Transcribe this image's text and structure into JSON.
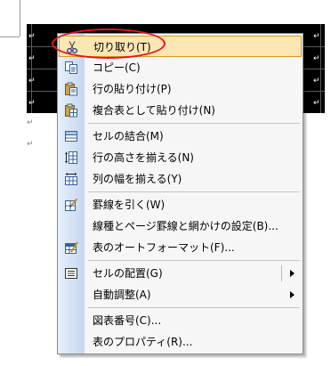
{
  "document": {
    "cell_mark": "↵",
    "paragraph_mark": "↵"
  },
  "menu": {
    "items": [
      {
        "label": "切り取り(T)",
        "icon": "scissors-icon",
        "highlighted": true,
        "has_submenu": false
      },
      {
        "label": "コピー(C)",
        "icon": "copy-icon",
        "highlighted": false,
        "has_submenu": false
      },
      {
        "label": "行の貼り付け(P)",
        "icon": "paste-icon",
        "highlighted": false,
        "has_submenu": false
      },
      {
        "label": "複合表として貼り付け(N)",
        "icon": "paste-table-icon",
        "highlighted": false,
        "has_submenu": false
      },
      {
        "label": "セルの結合(M)",
        "icon": "merge-cells-icon",
        "highlighted": false,
        "has_submenu": false
      },
      {
        "label": "行の高さを揃える(N)",
        "icon": "distribute-rows-icon",
        "highlighted": false,
        "has_submenu": false
      },
      {
        "label": "列の幅を揃える(Y)",
        "icon": "distribute-columns-icon",
        "highlighted": false,
        "has_submenu": false
      },
      {
        "label": "罫線を引く(W)",
        "icon": "draw-table-icon",
        "highlighted": false,
        "has_submenu": false
      },
      {
        "label": "線種とページ罫線と網かけの設定(B)...",
        "icon": "",
        "highlighted": false,
        "has_submenu": false
      },
      {
        "label": "表のオートフォーマット(F)...",
        "icon": "table-autoformat-icon",
        "highlighted": false,
        "has_submenu": false
      },
      {
        "label": "セルの配置(G)",
        "icon": "cell-alignment-icon",
        "highlighted": false,
        "has_submenu": true
      },
      {
        "label": "自動調整(A)",
        "icon": "",
        "highlighted": false,
        "has_submenu": true
      },
      {
        "label": "図表番号(C)...",
        "icon": "",
        "highlighted": false,
        "has_submenu": false
      },
      {
        "label": "表のプロパティ(R)...",
        "icon": "",
        "highlighted": false,
        "has_submenu": false
      }
    ]
  },
  "colors": {
    "highlight_ellipse": "#e8141b",
    "hover_fill": "#fbe6b4",
    "hover_border": "#d89a2b",
    "gutter_light": "#e8f0fb",
    "gutter_dark": "#c5d6ef"
  }
}
